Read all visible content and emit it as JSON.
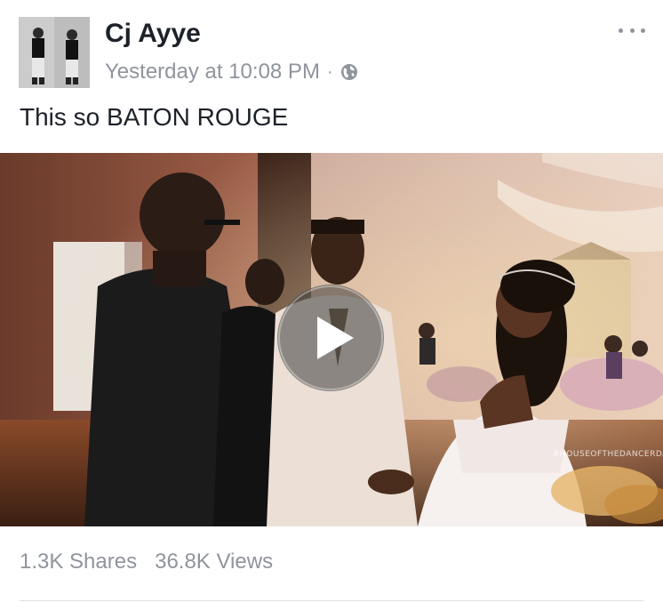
{
  "post": {
    "author": "Cj Ayye",
    "timestamp": "Yesterday at 10:08 PM",
    "separator": "·",
    "privacy_icon": "globe-icon",
    "text": "This so BATON ROUGE",
    "more_icon": "more-horizontal-icon"
  },
  "video": {
    "play_icon": "play-icon",
    "watermark": "#HOUSEOFTHEDANCERDANCE"
  },
  "stats": {
    "shares": "1.3K Shares",
    "views": "36.8K Views"
  },
  "colors": {
    "text_primary": "#1d2129",
    "text_secondary": "#90949c",
    "divider": "#dddfe2"
  }
}
